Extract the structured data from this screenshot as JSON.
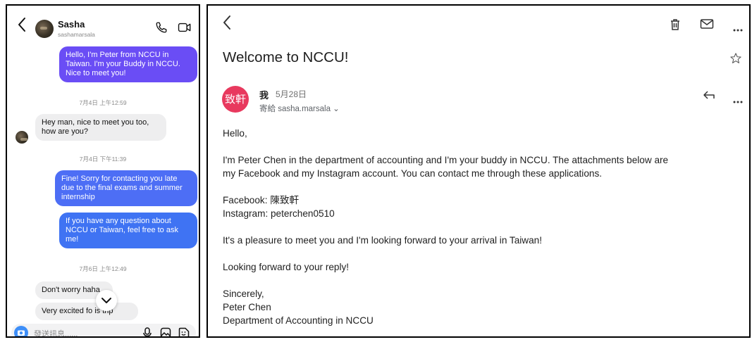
{
  "chat": {
    "header": {
      "name": "Sasha",
      "username": "sashamarsala"
    },
    "messages": [
      {
        "text": "Hello, I'm Peter from NCCU in Taiwan. I'm your Buddy in NCCU. Nice to meet you!",
        "side": "outgoing"
      },
      {
        "timestamp": "7月4日 上午12:59"
      },
      {
        "text": "Hey man, nice to meet you too, how are you?",
        "side": "incoming"
      },
      {
        "timestamp": "7月4日 下午11:39"
      },
      {
        "text": "Fine! Sorry for contacting you late due to the final exams and summer internship",
        "side": "outgoing"
      },
      {
        "text": "If you have any question about NCCU or Taiwan, feel free to ask me!",
        "side": "outgoing"
      },
      {
        "timestamp": "7月6日 上午12:49"
      },
      {
        "text": "Don't worry haha",
        "side": "incoming"
      },
      {
        "text": "Very excited fo   is trip",
        "side": "incoming"
      }
    ],
    "input_placeholder": "發送訊息......",
    "colors": {
      "outgoing_purple": "#6a4df5",
      "outgoing_blue": "#3f73f3",
      "incoming": "#eeeeef"
    },
    "icons": [
      "back-arrow-icon",
      "phone-icon",
      "video-icon",
      "camera-icon",
      "microphone-icon",
      "image-icon",
      "sticker-icon",
      "chevron-down-icon"
    ]
  },
  "email": {
    "subject": "Welcome to NCCU!",
    "sender_avatar_text": "致軒",
    "sender": "我",
    "date": "5月28日",
    "to": "寄給 sasha.marsala ⌄",
    "body": {
      "greeting": "Hello,",
      "para1_line1": "I'm Peter Chen in the department of accounting and I'm your buddy in NCCU. The attachments below are",
      "para1_line2": "my Facebook and my Instagram account. You can contact me through these applications.",
      "facebook": "Facebook: 陳致軒",
      "instagram": "Instagram: peterchen0510",
      "para2": "It's a pleasure to meet you and I'm looking forward to your arrival in Taiwan!",
      "para3": "Looking forward to your reply!",
      "closing": "Sincerely,",
      "signature_name": "Peter Chen",
      "signature_dept": "Department of Accounting in NCCU"
    },
    "colors": {
      "avatar_bg": "#e8395e"
    },
    "icons": [
      "back-arrow-icon",
      "trash-icon",
      "mail-icon",
      "more-icon",
      "star-icon",
      "reply-icon",
      "more-icon"
    ]
  }
}
